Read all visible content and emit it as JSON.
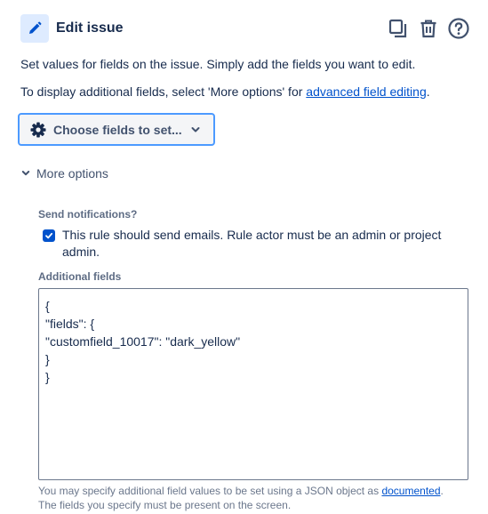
{
  "header": {
    "title": "Edit issue",
    "icons": [
      "pencil-icon",
      "copy-icon",
      "trash-icon",
      "help-icon"
    ],
    "accent_bg": "#deebff",
    "accent": "#0052cc"
  },
  "description": {
    "line1": "Set values for fields on the issue. Simply add the fields you want to edit.",
    "line2_prefix": "To display additional fields, select 'More options' for ",
    "line2_link": "advanced field editing",
    "line2_suffix": "."
  },
  "choose_fields": {
    "label": "Choose fields to set...",
    "icon": "gear-icon",
    "border_color": "#4c9aff"
  },
  "more_options": {
    "label": "More options",
    "expanded": true
  },
  "notifications": {
    "label": "Send notifications?",
    "checkbox_label": "This rule should send emails. Rule actor must be an admin or project admin.",
    "checked": true
  },
  "additional_fields": {
    "label": "Additional fields",
    "value": "{\n\"fields\": {\n\"customfield_10017\": \"dark_yellow\"\n}\n}"
  },
  "help": {
    "line1_prefix": "You may specify additional field values to be set using a JSON object as ",
    "line1_link": "documented",
    "line1_suffix": ".",
    "line2": "The fields you specify must be present on the screen."
  }
}
